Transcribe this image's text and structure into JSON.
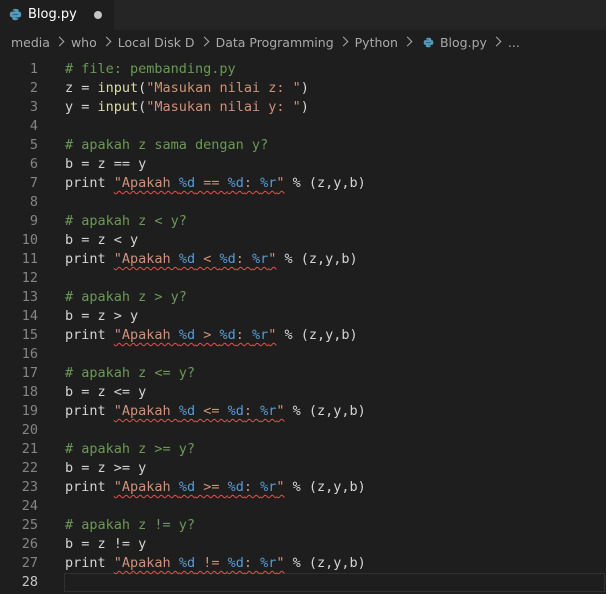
{
  "tab": {
    "label": "Blog.py",
    "icon": "python-file-icon"
  },
  "breadcrumb": {
    "items": [
      "media",
      "who",
      "Local Disk D",
      "Data Programming",
      "Python"
    ],
    "file": "Blog.py",
    "trailing": "..."
  },
  "editor": {
    "line_numbers": [
      "1",
      "2",
      "3",
      "4",
      "5",
      "6",
      "7",
      "8",
      "9",
      "10",
      "11",
      "12",
      "13",
      "14",
      "15",
      "16",
      "17",
      "18",
      "19",
      "20",
      "21",
      "22",
      "23",
      "24",
      "25",
      "26",
      "27",
      "28"
    ],
    "active_line": "28",
    "lines": [
      {
        "comment": "# file: pembanding.py"
      },
      {
        "var": "z = ",
        "func": "input",
        "open": "(",
        "str": "\"Masukan nilai z: \"",
        "close": ")"
      },
      {
        "var": "y = ",
        "func": "input",
        "open": "(",
        "str": "\"Masukan nilai y: \"",
        "close": ")"
      },
      {},
      {
        "comment": "# apakah z sama dengan y?"
      },
      {
        "text": "b = z == y"
      },
      {
        "kw": "print ",
        "s1": "\"Apakah ",
        "f1": "%d",
        "s2": " == ",
        "f2": "%d",
        "s3": ": ",
        "f3": "%r",
        "s4": "\"",
        "rest": " % (z,y,b)"
      },
      {},
      {
        "comment": "# apakah z < y?"
      },
      {
        "text": "b = z < y"
      },
      {
        "kw": "print ",
        "s1": "\"Apakah ",
        "f1": "%d",
        "s2": " < ",
        "f2": "%d",
        "s3": ": ",
        "f3": "%r",
        "s4": "\"",
        "rest": " % (z,y,b)"
      },
      {},
      {
        "comment": "# apakah z > y?"
      },
      {
        "text": "b = z > y"
      },
      {
        "kw": "print ",
        "s1": "\"Apakah ",
        "f1": "%d",
        "s2": " > ",
        "f2": "%d",
        "s3": ": ",
        "f3": "%r",
        "s4": "\"",
        "rest": " % (z,y,b)"
      },
      {},
      {
        "comment": "# apakah z <= y?"
      },
      {
        "text": "b = z <= y"
      },
      {
        "kw": "print ",
        "s1": "\"Apakah ",
        "f1": "%d",
        "s2": " <= ",
        "f2": "%d",
        "s3": ": ",
        "f3": "%r",
        "s4": "\"",
        "rest": " % (z,y,b)"
      },
      {},
      {
        "comment": "# apakah z >= y?"
      },
      {
        "text": "b = z >= y"
      },
      {
        "kw": "print ",
        "s1": "\"Apakah ",
        "f1": "%d",
        "s2": " >= ",
        "f2": "%d",
        "s3": ": ",
        "f3": "%r",
        "s4": "\"",
        "rest": " % (z,y,b)"
      },
      {},
      {
        "comment": "# apakah z != y?"
      },
      {
        "text": "b = z != y"
      },
      {
        "kw": "print ",
        "s1": "\"Apakah ",
        "f1": "%d",
        "s2": " != ",
        "f2": "%d",
        "s3": ": ",
        "f3": "%r",
        "s4": "\"",
        "rest": " % (z,y,b)"
      },
      {}
    ]
  },
  "colors": {
    "background": "#1e1e1e",
    "comment": "#6a9955",
    "function": "#dcdcaa",
    "string": "#ce9178",
    "format_specifier": "#569cd6",
    "error_squiggle": "#f14c4c",
    "python_icon_blue": "#3776ab",
    "python_icon_yellow": "#ffd43b"
  }
}
